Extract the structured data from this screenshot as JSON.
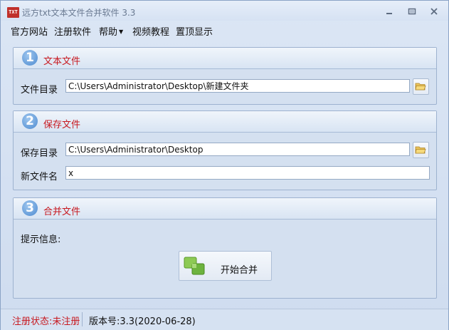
{
  "window": {
    "title": "远方txt文本文件合并软件 3.3",
    "icon_text": "TXT"
  },
  "menu": [
    "官方网站",
    "注册软件",
    "帮助",
    "视频教程",
    "置顶显示"
  ],
  "sections": {
    "s1": {
      "number": "1",
      "title": "文本文件",
      "dir_label": "文件目录",
      "dir_value": "C:\\Users\\Administrator\\Desktop\\新建文件夹"
    },
    "s2": {
      "number": "2",
      "title": "保存文件",
      "dir_label": "保存目录",
      "dir_value": "C:\\Users\\Administrator\\Desktop",
      "name_label": "新文件名",
      "name_value": "x"
    },
    "s3": {
      "number": "3",
      "title": "合并文件",
      "info_label": "提示信息:",
      "button_label": "开始合并"
    }
  },
  "status": {
    "registration": "注册状态:未注册",
    "version": "版本号:3.3(2020-06-28)"
  },
  "icons": {
    "app": "txt-app-icon",
    "minimize": "minimize-icon",
    "restore": "restore-icon",
    "close": "close-icon",
    "browse": "folder-open-icon",
    "merge": "merge-squares-icon"
  },
  "colors": {
    "accent_red": "#c7181f",
    "window_bg": "#d5e1f2"
  }
}
